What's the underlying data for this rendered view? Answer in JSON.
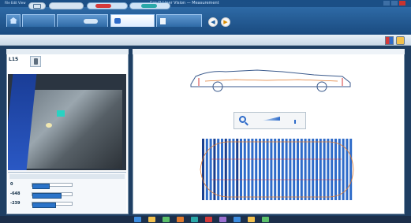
{
  "window": {
    "title": "Car-O-Liner Vision — Measurement",
    "menu": "File  Edit  View"
  },
  "ribbon": {
    "tabs": [
      {
        "label": "",
        "icon": "home-icon"
      },
      {
        "label": "",
        "icon": "vehicle-tab-icon"
      },
      {
        "label": "",
        "icon": "measure-tab-icon"
      },
      {
        "label": "",
        "icon": "report-tab-icon"
      }
    ],
    "nav_back_icon": "arrow-left-icon",
    "nav_fwd_icon": "arrow-right-icon"
  },
  "toolbar": {
    "view_icons": [
      "camera-icon",
      "car-side-icon",
      "car-top-icon"
    ],
    "right_icons": [
      "grid-view-icon",
      "settings-icon"
    ]
  },
  "left_panel": {
    "tabs": [
      "",
      "",
      ""
    ],
    "point_label": "L15",
    "meas_values": [
      "0",
      "-648",
      "-239"
    ],
    "meas_fills": [
      0.4,
      0.7,
      0.55
    ]
  },
  "right_panel": {
    "tabs": [
      "",
      "",
      "",
      ""
    ],
    "side_labels": [
      "",
      "",
      ""
    ]
  },
  "colors": {
    "ribbon": "#1a4b80",
    "accent": "#2e6bc9",
    "active_point": "#29d2c2",
    "measure_bar": "#2a73c9",
    "orange_trace": "#e07a2e"
  },
  "taskbar": {
    "icons": [
      "start-icon",
      "explorer-icon",
      "browser-icon",
      "app-icon",
      "measure-icon",
      "camera-icon",
      "folder-icon",
      "tool-icon",
      "settings-icon",
      "help-icon"
    ]
  }
}
